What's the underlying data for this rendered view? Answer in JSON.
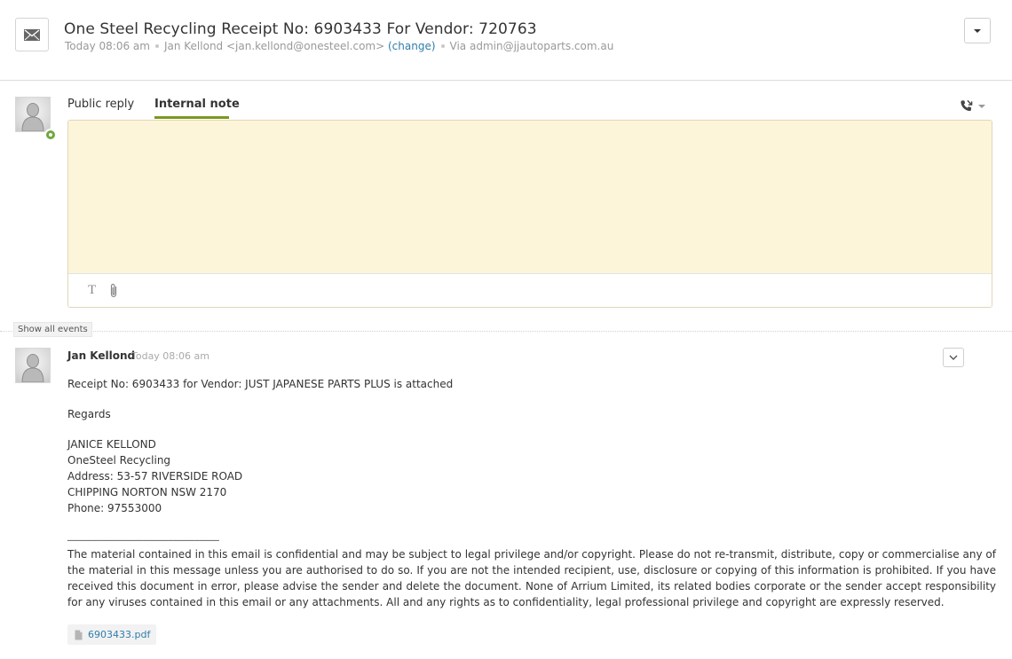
{
  "ticket": {
    "title": "One Steel Recycling Receipt No: 6903433 For Vendor: 720763",
    "time": "Today 08:06 am",
    "requester": "Jan Kellond <jan.kellond@onesteel.com>",
    "change_label": "(change)",
    "via": "Via admin@jjautoparts.com.au"
  },
  "composer": {
    "tabs": [
      "Public reply",
      "Internal note"
    ],
    "active_tab": "Internal note",
    "note_value": "",
    "note_bg_color": "#fdf5da",
    "tab_accent_color": "#7a9a1f"
  },
  "events_button": "Show all events",
  "comment": {
    "author": "Jan Kellond",
    "time": "Today 08:06 am",
    "lines": [
      "Receipt No: 6903433 for Vendor: JUST JAPANESE PARTS PLUS is attached",
      "Regards",
      "JANICE KELLOND",
      "OneSteel Recycling",
      "Address: 53-57 RIVERSIDE ROAD",
      "CHIPPING NORTON NSW 2170",
      "Phone: 97553000",
      "______________________________"
    ],
    "disclaimer": "The material contained in this email is confidential and may be subject to legal privilege and/or copyright. Please do not re-transmit, distribute, copy or commercialise any of the material in this message unless you are authorised to do so. If you are not the intended recipient, use, disclosure or copying of this information is prohibited. If you have received this document in error, please advise the sender and delete the document. None of Arrium Limited, its related bodies corporate or the sender accept responsibility for any viruses contained in this email or any attachments. All and any rights as to confidentiality, legal professional privilege and copyright are expressly reserved.",
    "attachment": "6903433.pdf"
  },
  "icons": {
    "ticket_type": "envelope-icon",
    "avatar": "default-avatar-icon",
    "status": "agent-status-icon",
    "phone": "phone-call-icon",
    "text_format": "text-format-icon",
    "attach": "paperclip-icon",
    "file": "file-icon",
    "dropdown": "chevron-down-icon"
  },
  "colors": {
    "link": "#2f7dab",
    "status_green": "#6fa83c"
  }
}
